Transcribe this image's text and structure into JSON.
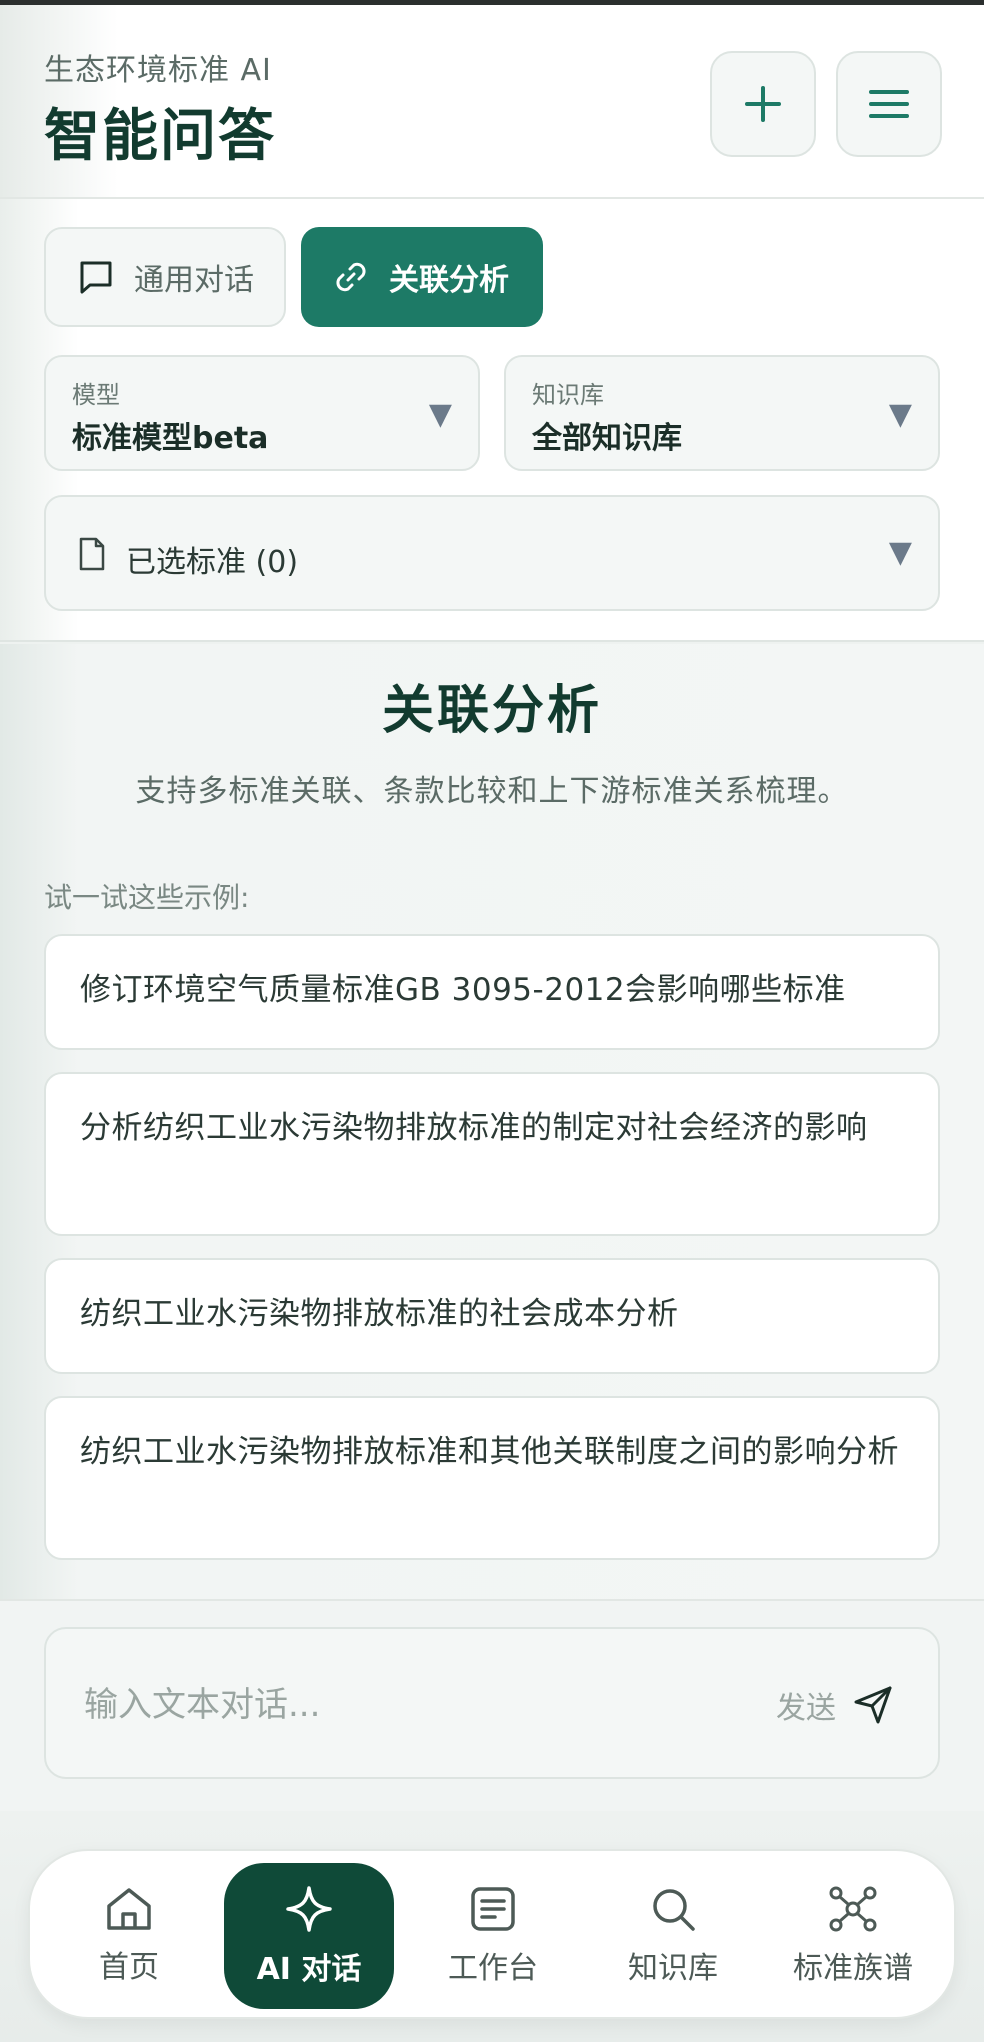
{
  "header": {
    "subtitle": "生态环境标准 AI",
    "title": "智能问答"
  },
  "modes": {
    "general": "通用对话",
    "related": "关联分析"
  },
  "selectors": {
    "model_label": "模型",
    "model_value": "标准模型beta",
    "kb_label": "知识库",
    "kb_value": "全部知识库",
    "selected_standards": "已选标准 (0)"
  },
  "main": {
    "title": "关联分析",
    "description": "支持多标准关联、条款比较和上下游标准关系梳理。",
    "try_label": "试一试这些示例:",
    "examples": [
      "修订环境空气质量标准GB 3095-2012会影响哪些标准",
      "分析纺织工业水污染物排放标准的制定对社会经济的影响",
      "纺织工业水污染物排放标准的社会成本分析",
      "纺织工业水污染物排放标准和其他关联制度之间的影响分析"
    ]
  },
  "input": {
    "placeholder": "输入文本对话...",
    "send_label": "发送"
  },
  "nav": {
    "items": [
      "首页",
      "AI 对话",
      "工作台",
      "知识库",
      "标准族谱"
    ]
  },
  "colors": {
    "accent": "#1d7a66",
    "dark_accent": "#0f4a38",
    "title": "#123b2f"
  }
}
